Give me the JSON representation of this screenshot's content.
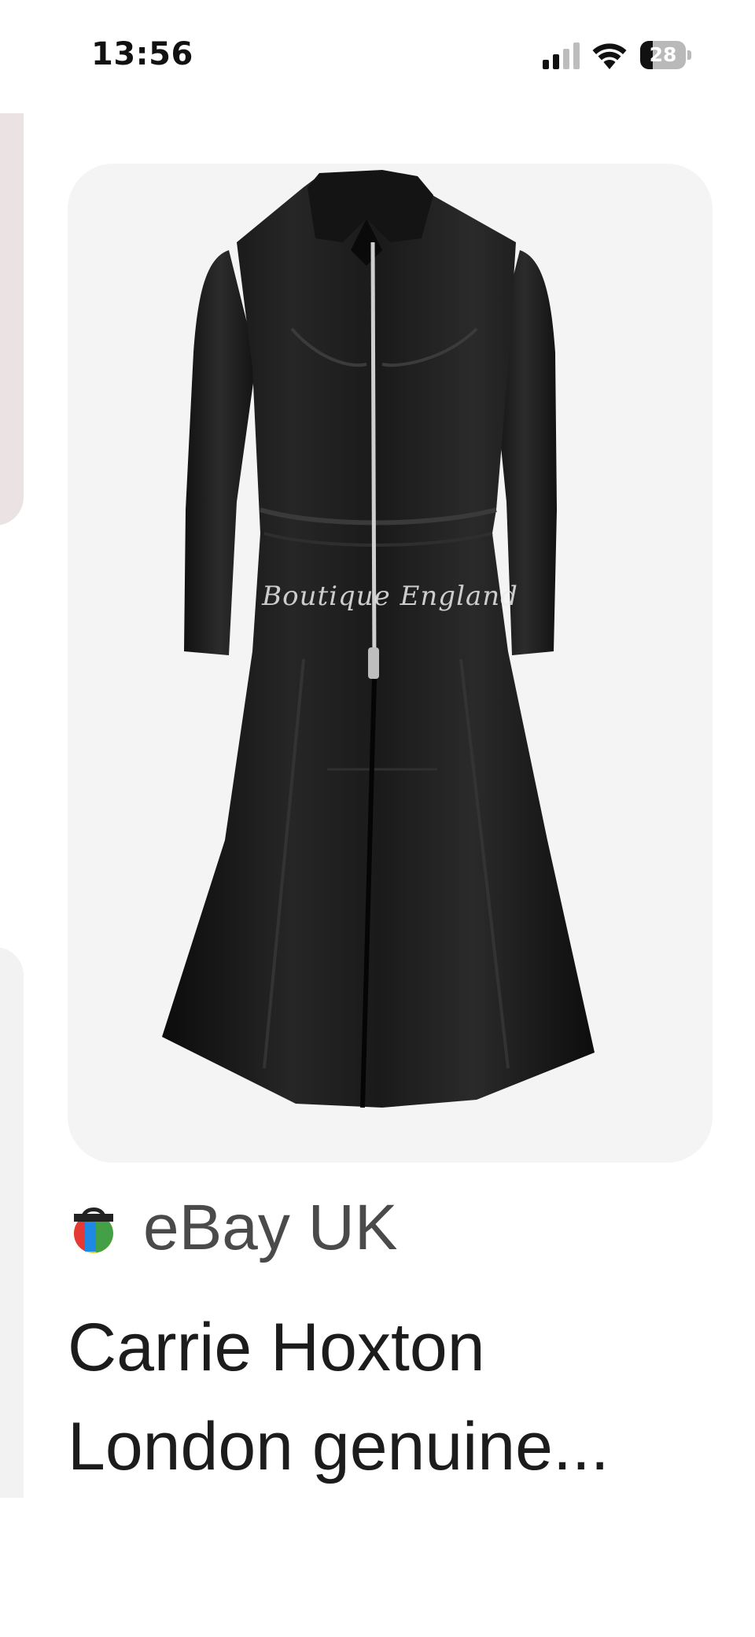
{
  "status_bar": {
    "time": "13:56",
    "battery_level": "28",
    "battery_fraction": 0.28,
    "icons": [
      "signal-icon",
      "wifi-icon",
      "battery-icon"
    ]
  },
  "product": {
    "image_watermark": "Boutique England",
    "source": "eBay UK",
    "source_icon": "shopping-bag-icon",
    "title_line1": "Carrie Hoxton",
    "title_line2": "London genuine..."
  },
  "colors": {
    "card_background": "#f5f4f4",
    "peek_card_top": "#ebe3e3",
    "peek_card_bottom": "#f3f2f2",
    "title_text": "#1c1c1c",
    "source_text": "#4a4a4a"
  }
}
